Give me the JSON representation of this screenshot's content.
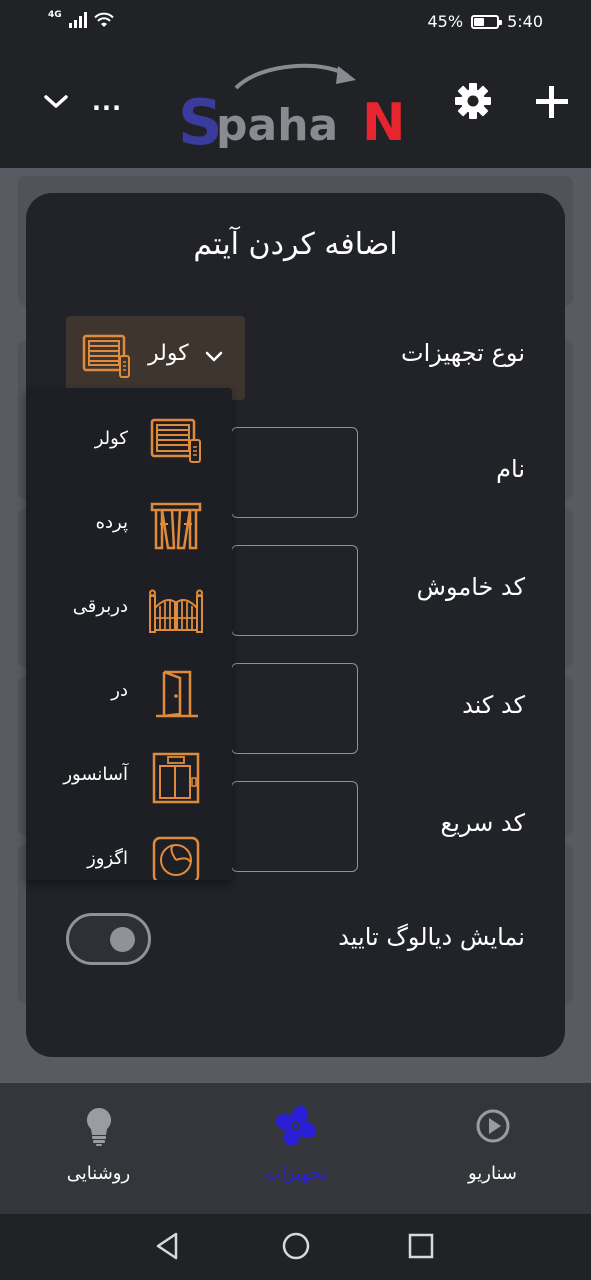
{
  "status_bar": {
    "network_type": "4G",
    "battery_percent": "45%",
    "battery_level": 0.45,
    "time": "5:40",
    "icons": [
      "signal-icon",
      "wifi-icon",
      "battery-icon"
    ]
  },
  "app_bar": {
    "logo_text": "SpahaN",
    "more_label": "...",
    "icons": [
      "chevron-down-icon",
      "more-icon",
      "gear-icon",
      "plus-icon"
    ]
  },
  "modal": {
    "title": "اضافه کردن آیتم",
    "fields": {
      "device_type_label": "نوع تجهیزات",
      "name_label": "نام",
      "off_code_label": "کد خاموش",
      "slow_code_label": "کد کند",
      "fast_code_label": "کد سریع",
      "confirm_dialog_label": "نمایش دیالوگ تایید"
    },
    "device_type_selected": "کولر",
    "name_value": "",
    "off_code_value": "",
    "slow_code_value": "",
    "fast_code_value": "",
    "confirm_dialog_enabled": false
  },
  "device_menu": {
    "items": [
      {
        "label": "کولر",
        "icon": "cooler-icon"
      },
      {
        "label": "پرده",
        "icon": "curtain-icon"
      },
      {
        "label": "دربرقی",
        "icon": "electric-gate-icon"
      },
      {
        "label": "در",
        "icon": "door-icon"
      },
      {
        "label": "آسانسور",
        "icon": "elevator-icon"
      },
      {
        "label": "اگزوز",
        "icon": "exhaust-fan-icon"
      }
    ]
  },
  "bottom_nav": {
    "items": [
      {
        "label": "روشنایی",
        "icon": "lightbulb-icon",
        "active": false
      },
      {
        "label": "تجهیزات",
        "icon": "fan-icon",
        "active": true
      },
      {
        "label": "سناریو",
        "icon": "play-circle-icon",
        "active": false
      }
    ]
  },
  "colors": {
    "accent_orange": "#e08a3c",
    "active_blue": "#2a1fd6",
    "logo_blue": "#3a3b9a",
    "logo_red": "#e8252e",
    "modal_bg": "#212329"
  }
}
